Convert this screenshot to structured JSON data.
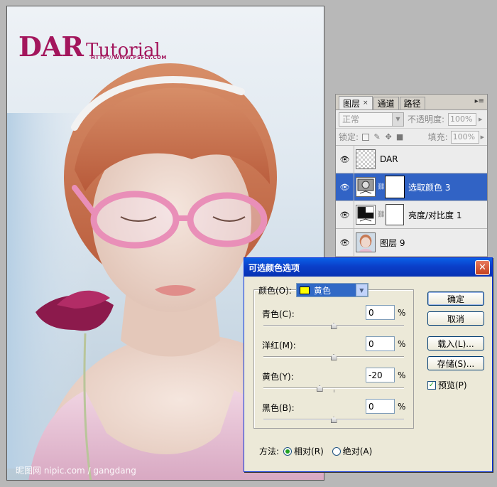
{
  "canvas": {
    "brand_main": "DAR",
    "brand_sub": "Tutorial",
    "brand_url": "HTTP://WWW.PSFLY.COM",
    "watermark": "昵图网 nipic.com / gangdang"
  },
  "layers_panel": {
    "tabs": [
      {
        "label": "图层",
        "close": "×"
      },
      {
        "label": "通道"
      },
      {
        "label": "路径"
      }
    ],
    "menu_icon": "▸≡",
    "blend_mode": "正常",
    "opacity_label": "不透明度:",
    "opacity_value": "100%",
    "lock_label": "锁定:",
    "fill_label": "填充:",
    "fill_value": "100%",
    "layers": [
      {
        "name": "DAR",
        "type": "text-layer",
        "visible": true,
        "selected": false
      },
      {
        "name": "选取颜色 3",
        "type": "adjustment-layer",
        "visible": true,
        "selected": true
      },
      {
        "name": "亮度/对比度 1",
        "type": "adjustment-layer",
        "visible": true,
        "selected": false
      },
      {
        "name": "图层 9",
        "type": "image-layer",
        "visible": true,
        "selected": false
      }
    ]
  },
  "dialog": {
    "title": "可选颜色选项",
    "close_label": "✕",
    "colors_label": "颜色(O):",
    "colors_value": "黄色",
    "swatch_color": "#ffff00",
    "sliders": [
      {
        "label": "青色(C):",
        "value": "0",
        "unit": "%",
        "level": 0
      },
      {
        "label": "洋红(M):",
        "value": "0",
        "unit": "%",
        "level": 0
      },
      {
        "label": "黄色(Y):",
        "value": "-20",
        "unit": "%",
        "level": -20
      },
      {
        "label": "黑色(B):",
        "value": "0",
        "unit": "%",
        "level": 0
      }
    ],
    "buttons": {
      "ok": "确定",
      "cancel": "取消",
      "load": "载入(L)...",
      "save": "存储(S)..."
    },
    "preview_label": "预览(P)",
    "preview_checked": true,
    "method_label": "方法:",
    "method_options": [
      {
        "label": "相对(R)",
        "selected": true
      },
      {
        "label": "绝对(A)",
        "selected": false
      }
    ]
  }
}
